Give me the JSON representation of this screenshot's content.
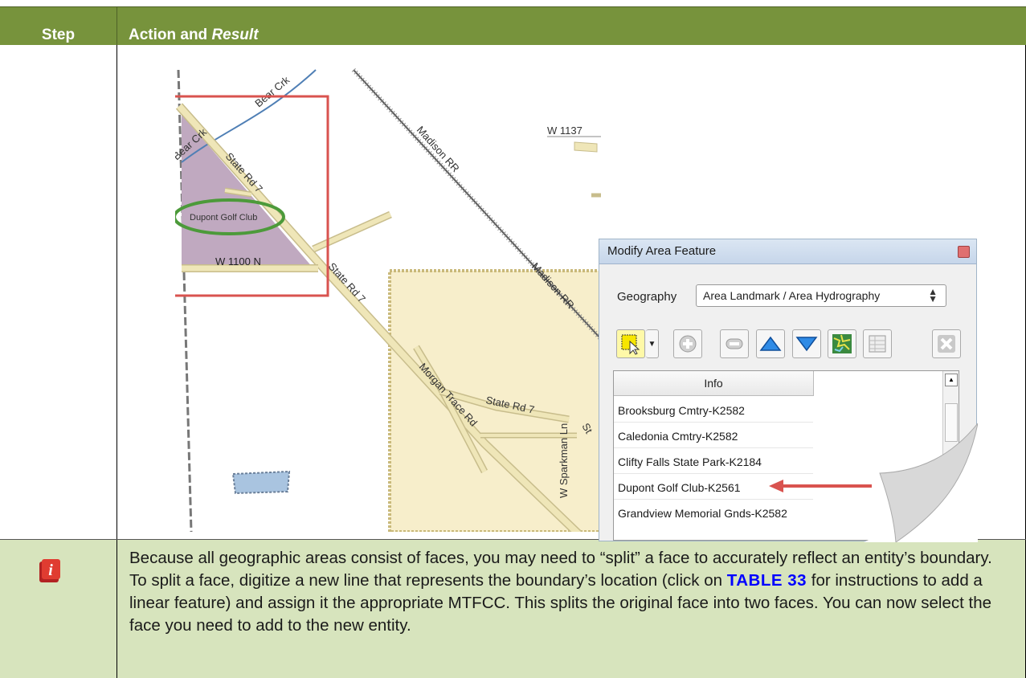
{
  "table": {
    "header_step": "Step",
    "header_action": "Action and ",
    "header_result": "Result"
  },
  "map": {
    "labels": {
      "bear_crk_1": "Bear Crk",
      "bear_crk_2": "Bear Crk",
      "state_rd_a": "State Rd 7",
      "state_rd_b": "State Rd 7",
      "state_rd_c": "State Rd 7",
      "madison_a": "Madison RR",
      "madison_b": "Madison RR",
      "w1137": "W 1137",
      "w1100": "W 1100 N",
      "dupont": "Dupont Golf Club",
      "morgan": "Morgan Trace Rd",
      "sparkman": "W Sparkman Ln",
      "st": "St"
    },
    "colors": {
      "road": "#efe6b8",
      "road_edge": "#c8bd8c",
      "golf": "#c0a9c0",
      "park": "#f7eecb",
      "water": "#a9c4e0",
      "red_box": "#d9534f",
      "green_ellipse": "#4c9a3a"
    }
  },
  "dialog": {
    "title": "Modify Area Feature",
    "geography_label": "Geography",
    "geography_value": "Area Landmark / Area Hydrography",
    "list_header": "Info",
    "items": [
      "Brooksburg Cmtry-K2582",
      "Caledonia Cmtry-K2582",
      "Clifty Falls State Park-K2184",
      "Dupont Golf Club-K2561",
      "Grandview Memorial Gnds-K2582"
    ],
    "toolbar_icons": [
      "select-icon",
      "dropdown-arrow-icon",
      "add-icon",
      "remove-icon",
      "move-up-icon",
      "move-down-icon",
      "map-icon",
      "table-icon",
      "delete-icon"
    ]
  },
  "note": {
    "text_1": "Because all geographic areas consist of faces, you may need to “split” a face to accurately reflect an entity’s boundary. To split a face, digitize a new line that represents the boundary’s location (click on ",
    "link": "TABLE 33",
    "text_2": " for instructions to add a linear feature) and assign it the appropriate MTFCC. This splits the original face into two faces. You can now select the face you need to add to the new entity."
  }
}
